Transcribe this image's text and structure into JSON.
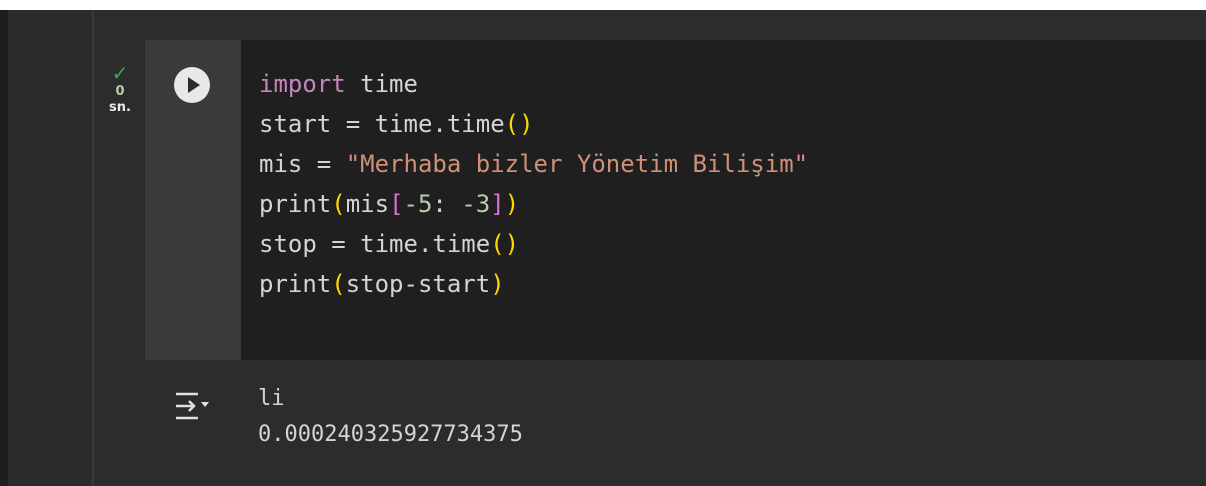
{
  "cell": {
    "status": {
      "check_icon": "check-icon",
      "duration_value": "0",
      "duration_unit": "sn."
    },
    "run_button_icon": "play-icon",
    "code_lines": [
      "import time",
      "start = time.time()",
      "mis = \"Merhaba bizler Yönetim Bilişim\"",
      "print(mis[-5: -3])",
      "stop = time.time()",
      "print(stop-start)"
    ],
    "tokens": {
      "import_kw": "import",
      "time_mod": "time",
      "start": "start",
      "time_call_a": "time.time",
      "mis": "mis",
      "string_lit": "\"Merhaba bizler Yönetim Bilişim\"",
      "print_a": "print",
      "mis_ref": "mis",
      "neg5": "-5",
      "neg3": "-3",
      "stop": "stop",
      "time_call_b": "time.time",
      "print_b": "print",
      "stop_start": "stop-start"
    },
    "output": {
      "icon": "output-toggle-icon",
      "lines": [
        "li",
        "0.000240325927734375"
      ]
    }
  }
}
